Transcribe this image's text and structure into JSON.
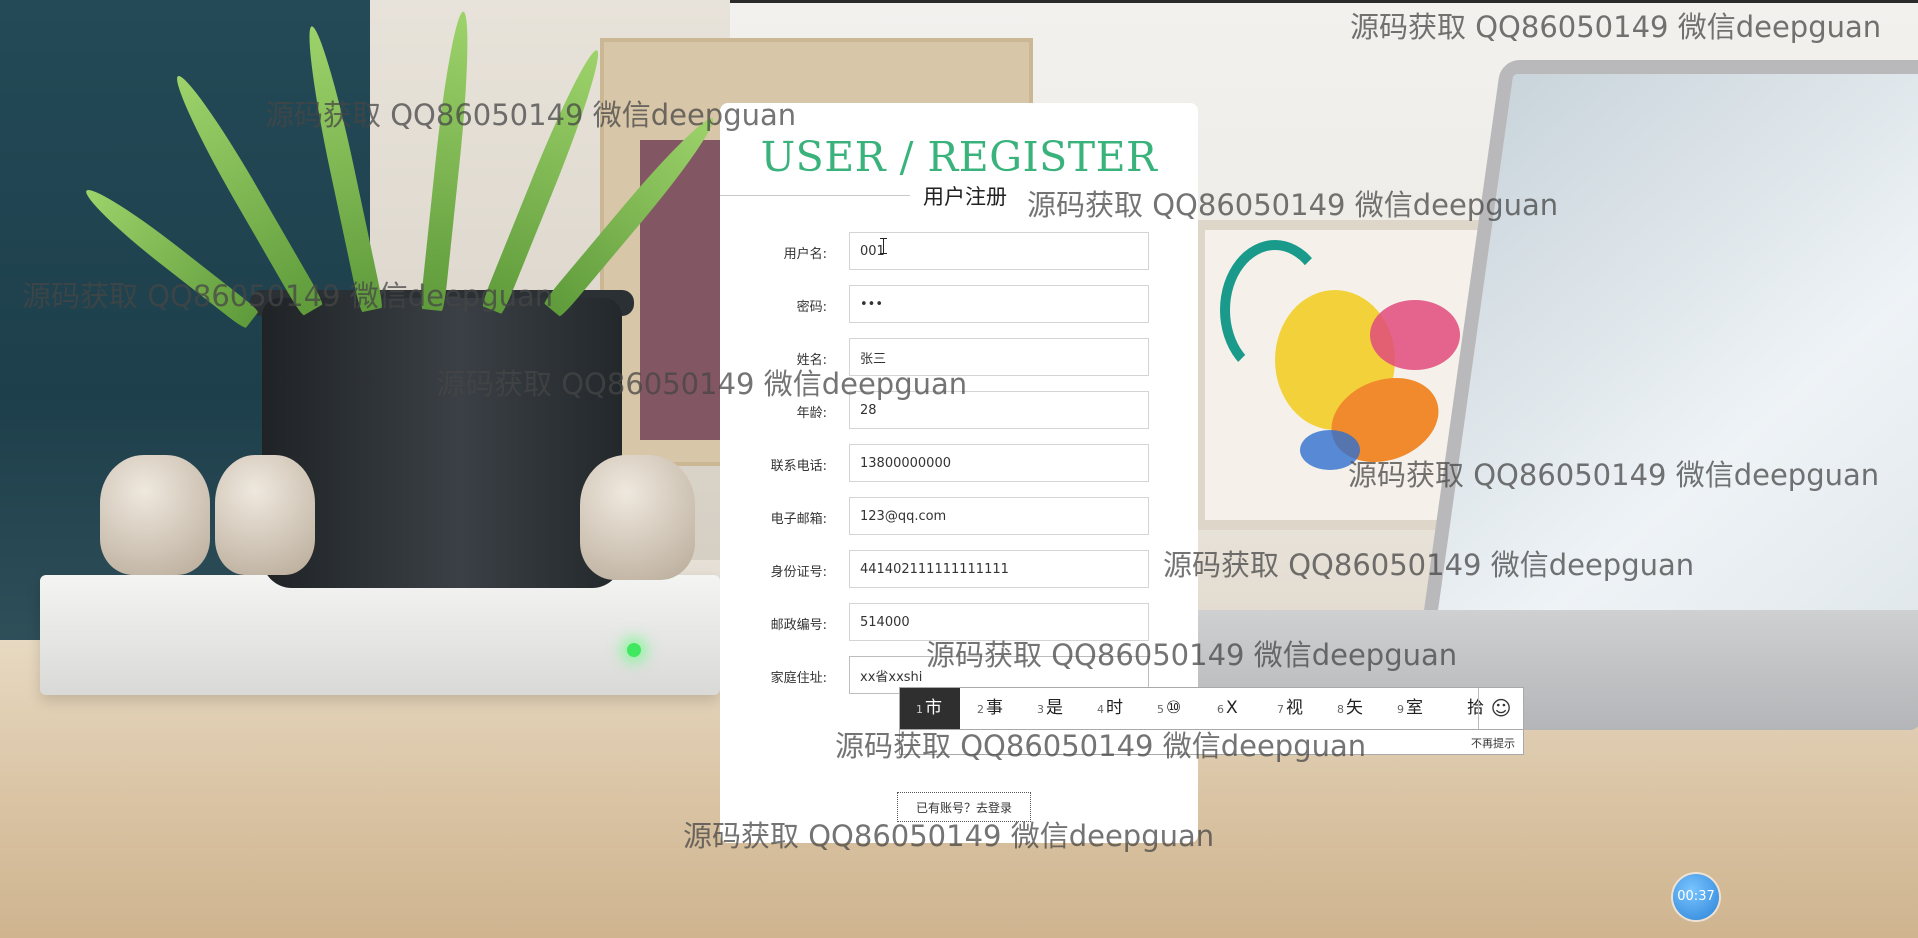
{
  "register_card": {
    "title": "USER / REGISTER",
    "subtitle": "用户注册",
    "fields": [
      {
        "label": "用户名:",
        "value": "001",
        "type": "text"
      },
      {
        "label": "密码:",
        "value": "•••",
        "type": "password"
      },
      {
        "label": "姓名:",
        "value": "张三",
        "type": "text"
      },
      {
        "label": "年龄:",
        "value": "28",
        "type": "text"
      },
      {
        "label": "联系电话:",
        "value": "13800000000",
        "type": "text"
      },
      {
        "label": "电子邮箱:",
        "value": "123@qq.com",
        "type": "text"
      },
      {
        "label": "身份证号:",
        "value": "441402111111111111",
        "type": "text"
      },
      {
        "label": "邮政编号:",
        "value": "514000",
        "type": "text"
      },
      {
        "label": "家庭住址:",
        "value": "xx省xxshi",
        "type": "text"
      }
    ],
    "login_link": "已有账号？去登录"
  },
  "ime": {
    "candidates": [
      {
        "num": "1",
        "text": "市"
      },
      {
        "num": "2",
        "text": "事"
      },
      {
        "num": "3",
        "text": "是"
      },
      {
        "num": "4",
        "text": "时"
      },
      {
        "num": "5",
        "text": "⑩"
      },
      {
        "num": "6",
        "text": "X"
      },
      {
        "num": "7",
        "text": "视"
      },
      {
        "num": "8",
        "text": "矢"
      },
      {
        "num": "9",
        "text": "室"
      },
      {
        "num": "",
        "text": "拾"
      }
    ],
    "emoji_symbol": "☺",
    "tip_close": "不再提示"
  },
  "watermarks": [
    "源码获取 QQ86050149 微信deepguan",
    "源码获取 QQ86050149 微信deepguan",
    "源码获取 QQ86050149 微信deepguan",
    "源码获取 QQ86050149 微信deepguan",
    "源码获取 QQ86050149 微信deepguan",
    "源码获取 QQ86050149 微信deepguan",
    "源码获取 QQ86050149 微信deepguan",
    "源码获取 QQ86050149 微信deepguan",
    "源码获取 QQ86050149 微信deepguan",
    "源码获取 QQ86050149 微信deepguan"
  ],
  "timer": "00:37",
  "colors": {
    "title_green": "#3ab27b",
    "card_bg": "#ffffff",
    "ime_active_bg": "#2f2f2f"
  }
}
